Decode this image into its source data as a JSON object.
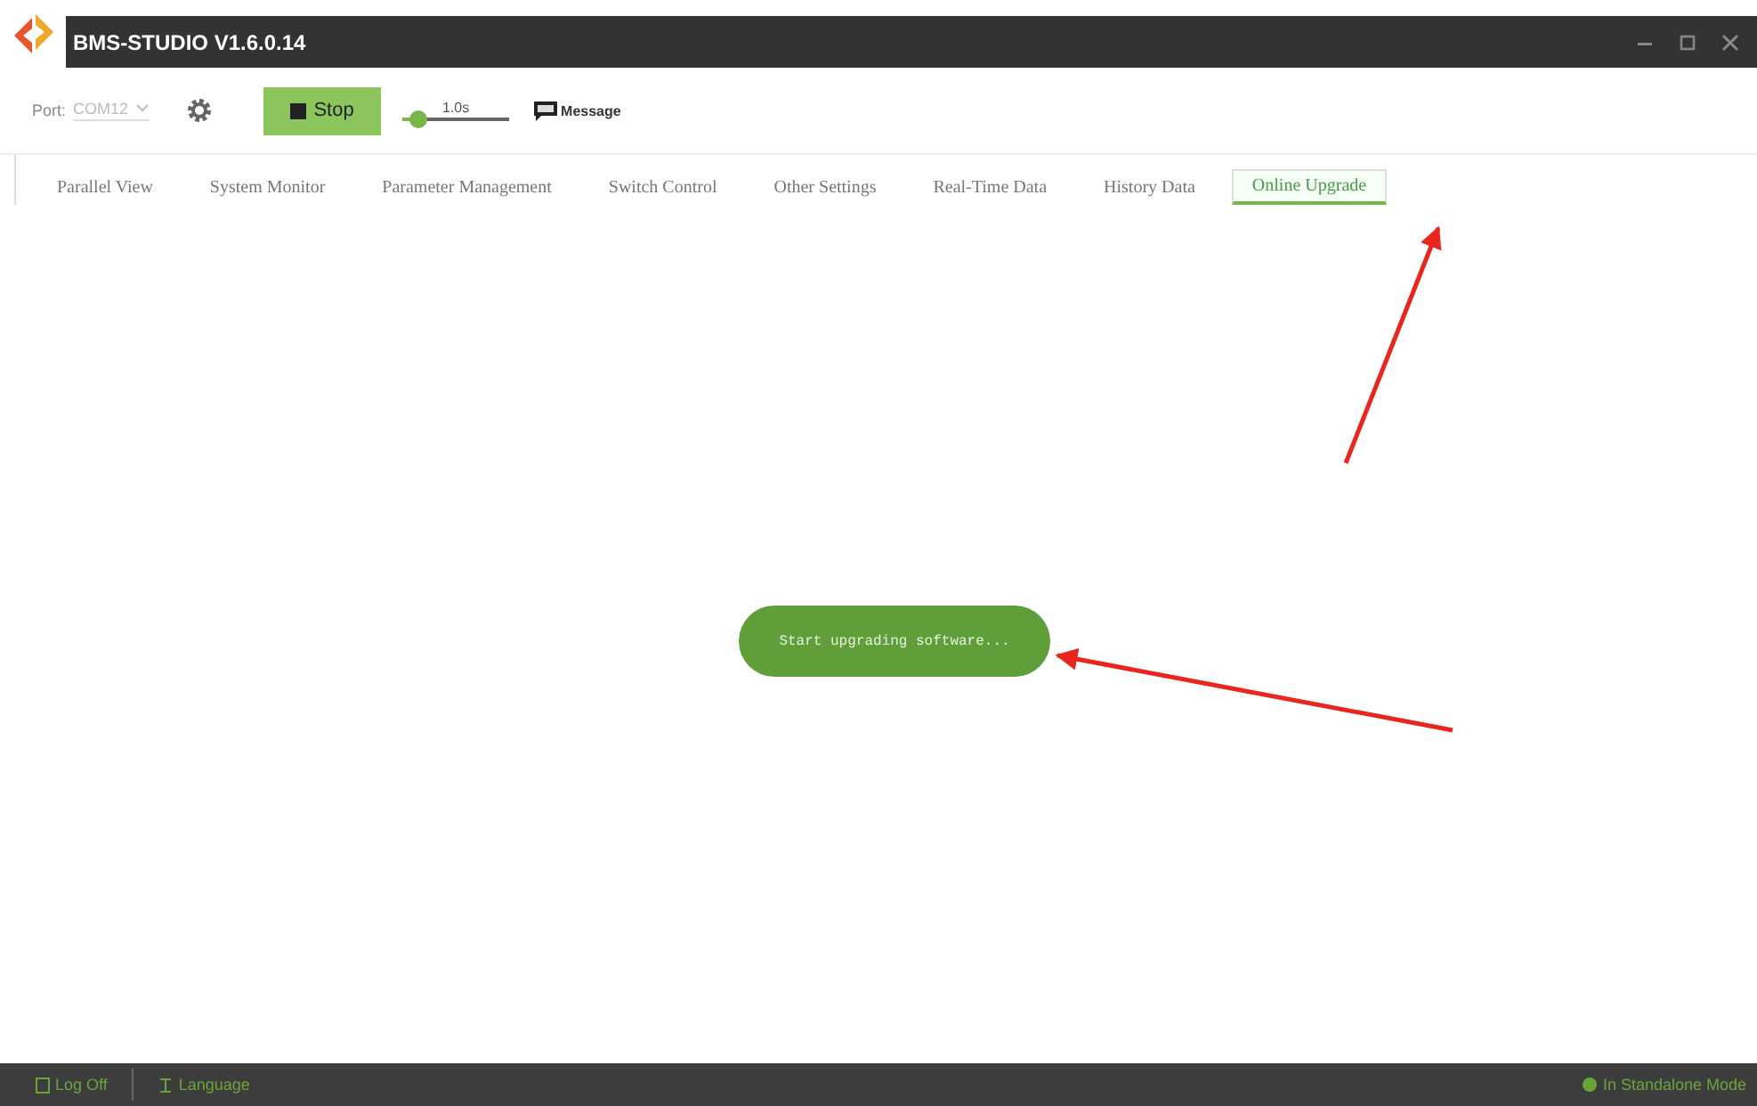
{
  "window": {
    "title": "BMS-STUDIO  V1.6.0.14"
  },
  "toolbar": {
    "port_label": "Port:",
    "port_value": "COM12",
    "stop_button": "Stop",
    "interval_slider": {
      "label": "1.0s",
      "level": 0.15
    },
    "message_button": "Message"
  },
  "tabs": [
    {
      "label": "Parallel View",
      "selected": false
    },
    {
      "label": "System Monitor",
      "selected": false
    },
    {
      "label": "Parameter Management",
      "selected": false
    },
    {
      "label": "Switch Control",
      "selected": false
    },
    {
      "label": "Other Settings",
      "selected": false
    },
    {
      "label": "Real-Time Data",
      "selected": false
    },
    {
      "label": "History Data",
      "selected": false
    },
    {
      "label": "Online Upgrade",
      "selected": true
    }
  ],
  "toast": "Start upgrading software...",
  "status_bar": {
    "log_button": "Log Off",
    "language_button": "Language",
    "mode": "In Standalone Mode"
  }
}
